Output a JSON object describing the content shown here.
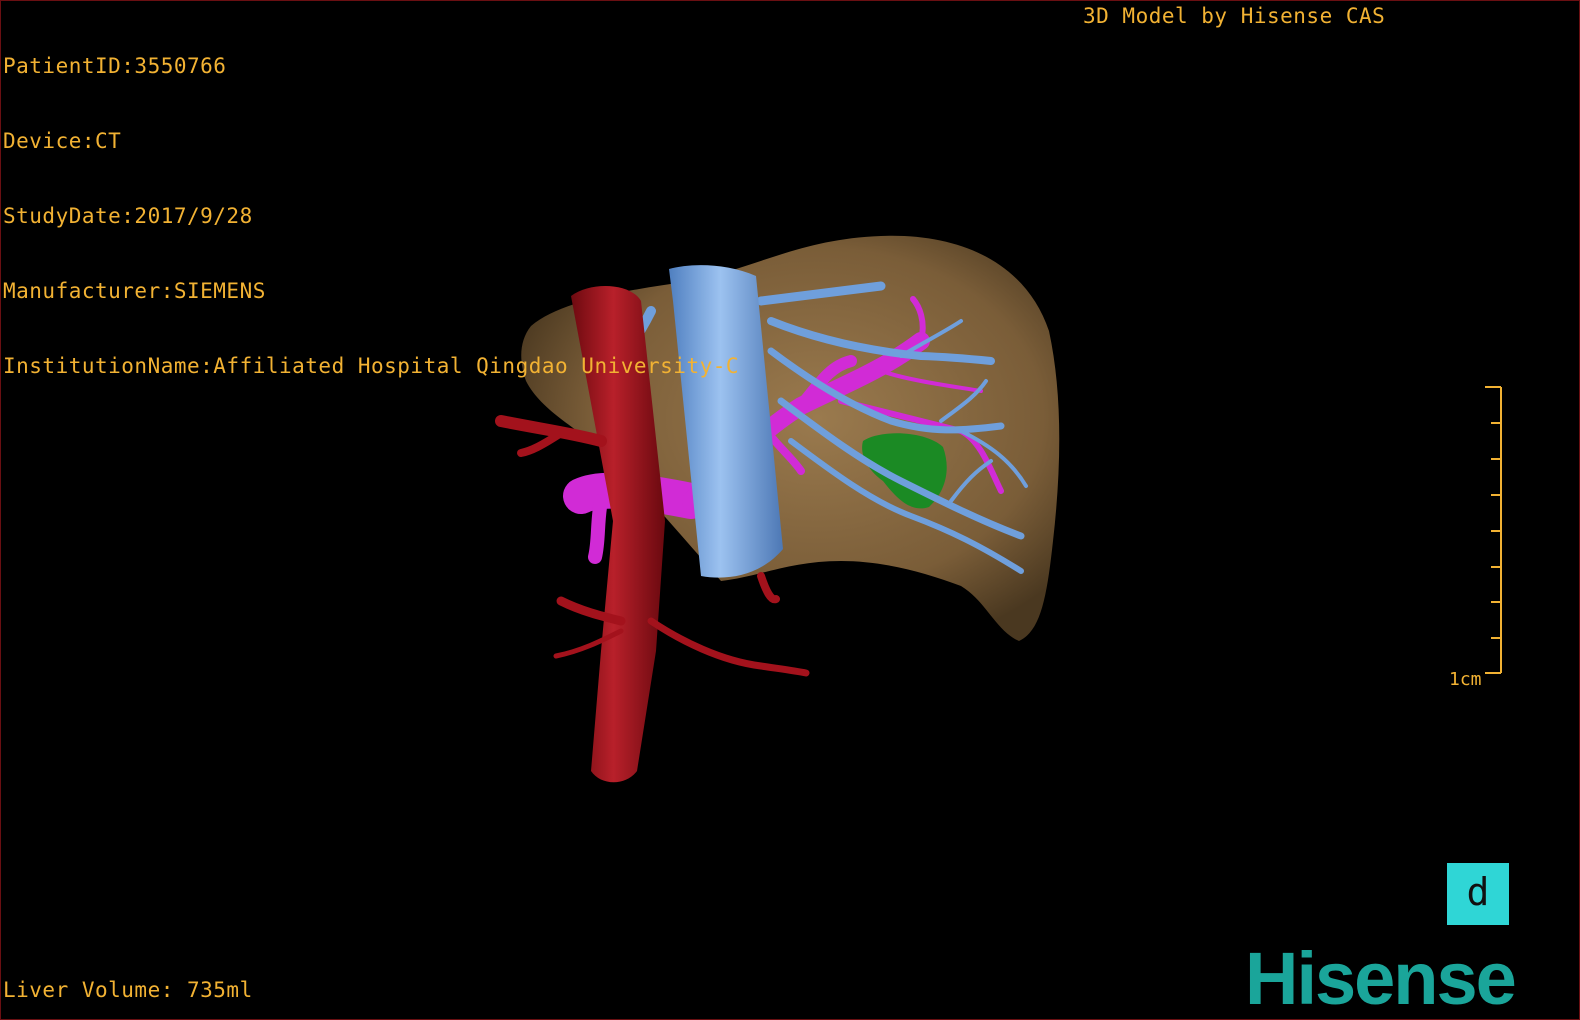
{
  "patient_info": {
    "patient_id": "PatientID:3550766",
    "device": "Device:CT",
    "study_date": "StudyDate:2017/9/28",
    "manufacturer": "Manufacturer:SIEMENS",
    "institution": "InstitutionName:Affiliated Hospital Qingdao University-C"
  },
  "model_credit": "3D Model by Hisense CAS",
  "liver_volume": "Liver Volume: 735ml",
  "scale_bar": {
    "label": "1cm"
  },
  "toolbar": {
    "d_button_label": "d"
  },
  "brand": {
    "logo_text": "Hisense"
  },
  "colors": {
    "overlay_text": "#f2b233",
    "liver": "#8a6b43",
    "artery": "#a3121c",
    "vena_cava": "#6f9fdc",
    "portal_vein": "#d12bd6",
    "gallbladder": "#1b8a24",
    "tool_button": "#2fd6d6",
    "logo": "#1aa59a"
  }
}
